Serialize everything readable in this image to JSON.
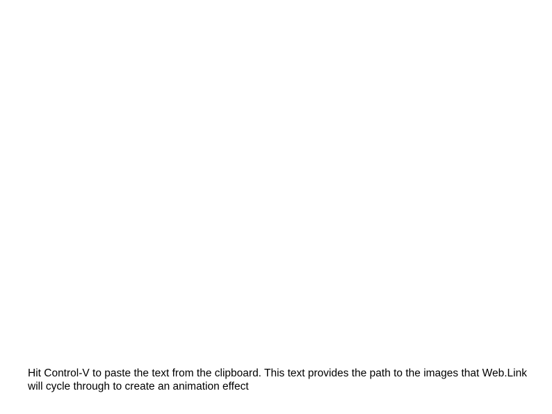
{
  "instruction": "Hit Control-V to paste the text from the clipboard. This text provides the path to the images that Web.Link will cycle through to create an animation effect"
}
